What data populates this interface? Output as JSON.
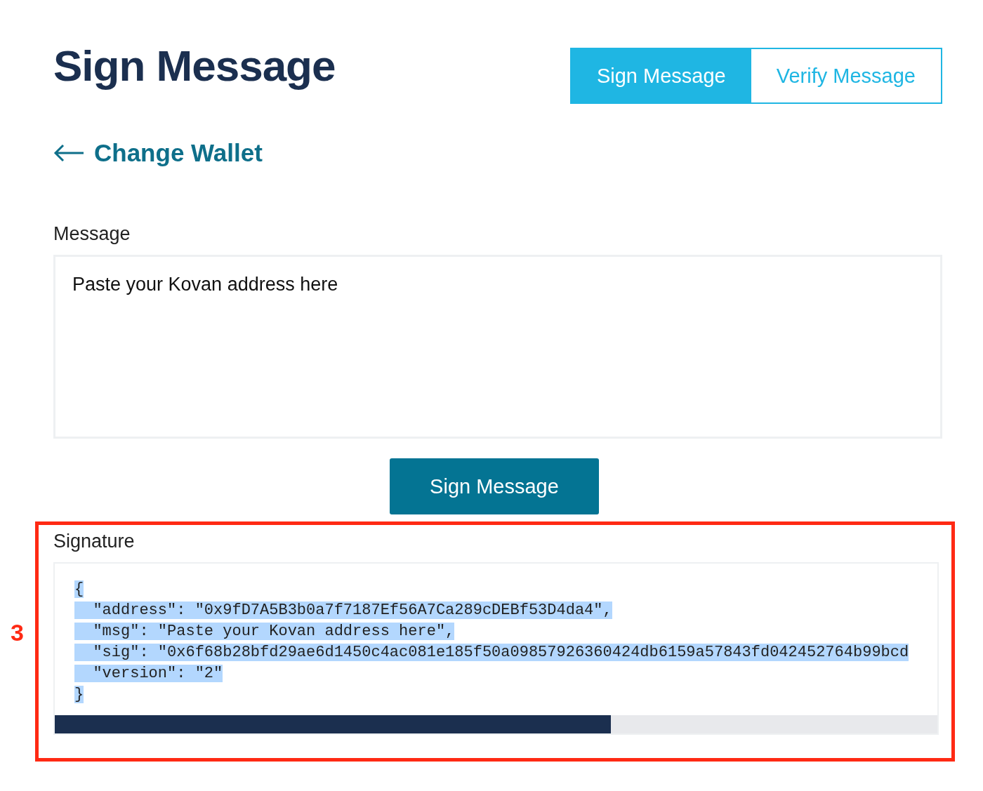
{
  "page_title": "Sign Message",
  "tabs": [
    {
      "label": "Sign Message",
      "selected": true
    },
    {
      "label": "Verify Message",
      "selected": false
    }
  ],
  "back_link": "Change Wallet",
  "message": {
    "label": "Message",
    "value": "Paste your Kovan address here"
  },
  "sign_button": "Sign Message",
  "annotation": {
    "number": "3"
  },
  "signature": {
    "label": "Signature",
    "lines": [
      "{",
      "  \"address\": \"0x9fD7A5B3b0a7f7187Ef56A7Ca289cDEBf53D4da4\",",
      "  \"msg\": \"Paste your Kovan address here\",",
      "  \"sig\": \"0x6f68b28bfd29ae6d1450c4ac081e185f50a09857926360424db6159a57843fd042452764b99bcd",
      "  \"version\": \"2\"",
      "}"
    ]
  }
}
